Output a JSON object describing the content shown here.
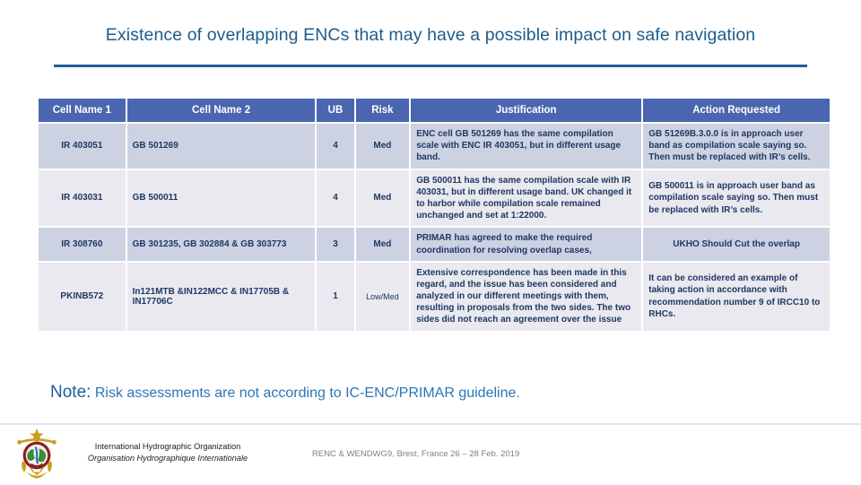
{
  "slide": {
    "title": "Existence of overlapping ENCs that may have a possible impact on safe navigation"
  },
  "table": {
    "headers": {
      "cell_name_1": "Cell Name 1",
      "cell_name_2": "Cell Name 2",
      "ub": "UB",
      "risk": "Risk",
      "justification": "Justification",
      "action_requested": "Action Requested"
    },
    "rows": [
      {
        "cell_name_1": "IR 403051",
        "cell_name_2": "GB 501269",
        "ub": "4",
        "risk": "Med",
        "justification": "ENC cell GB 501269 has the same compilation scale with ENC IR 403051, but in different usage band.",
        "action_requested": "GB 51269B.3.0.0 is in approach user band as compilation scale saying so. Then must be replaced with IR’s cells."
      },
      {
        "cell_name_1": "IR 403031",
        "cell_name_2": "GB 500011",
        "ub": "4",
        "risk": "Med",
        "justification": "GB 500011 has the same compilation scale with IR 403031, but in different usage band. UK changed it to harbor while compilation scale remained unchanged and set at 1:22000.",
        "action_requested": "GB 500011 is in approach user band as compilation scale saying so. Then must be replaced with IR’s cells."
      },
      {
        "cell_name_1": "IR 308760",
        "cell_name_2": "GB 301235, GB 302884 & GB 303773",
        "ub": "3",
        "risk": "Med",
        "justification": "PRIMAR has agreed to make the required coordination for resolving overlap cases,",
        "action_requested": "UKHO Should Cut the overlap"
      },
      {
        "cell_name_1": "PKINB572",
        "cell_name_2": "In121MTB &IN122MCC & IN17705B & IN17706C",
        "ub": "1",
        "risk": "Low/Med",
        "justification": "Extensive correspondence has been made in this regard, and the issue has been considered and analyzed in our different meetings with them, resulting in proposals from the two sides. The two sides did not reach an agreement over the issue",
        "action_requested": "It can be considered an example of taking action in accordance with recommendation number 9 of IRCC10 to RHCs."
      }
    ]
  },
  "note": {
    "label": "Note:",
    "text": " Risk assessments are not according to IC-ENC/PRIMAR guideline."
  },
  "footer": {
    "org_en": "International Hydrographic Organization",
    "org_fr": "Organisation Hydrographique Internationale",
    "event": "RENC & WENDWG9, Brest,  France 26 – 28 Feb. 2019"
  },
  "colors": {
    "header_blue": "#4A66B0",
    "title_blue": "#1F5C8B",
    "rule_blue": "#1F5C99",
    "row_odd": "#ccd2e2",
    "row_even": "#e9e9ef",
    "cell_red": "#D32F2F",
    "body_navy": "#1F3864",
    "note_blue": "#2E74B5",
    "footer_grey": "#808080"
  }
}
